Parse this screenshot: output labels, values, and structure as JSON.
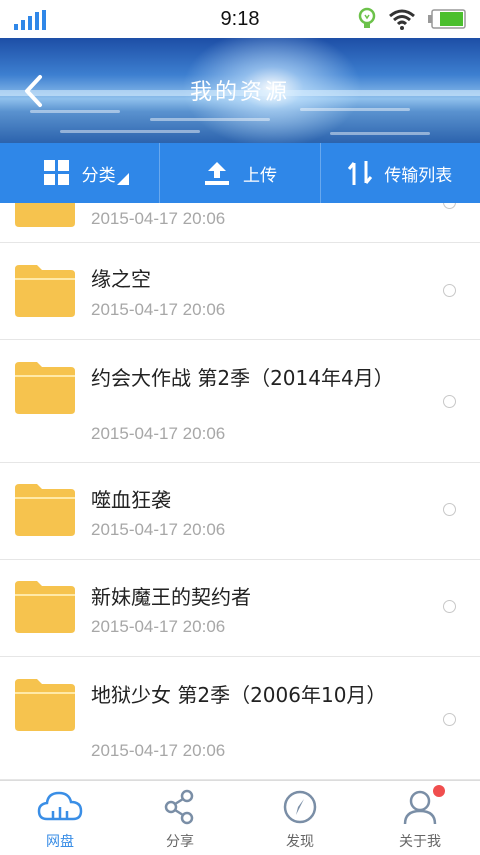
{
  "status_bar": {
    "time": "9:18"
  },
  "header": {
    "title": "我的资源"
  },
  "toolbar": {
    "category": "分类",
    "upload": "上传",
    "transfer_list": "传输列表"
  },
  "files": [
    {
      "name": "",
      "date": "2015-04-17  20:06"
    },
    {
      "name": "缘之空",
      "date": "2015-04-17  20:06"
    },
    {
      "name": "约会大作战 第2季（2014年4月）",
      "date": "2015-04-17  20:06"
    },
    {
      "name": "噬血狂袭",
      "date": "2015-04-17  20:06"
    },
    {
      "name": "新妹魔王的契约者",
      "date": "2015-04-17  20:06"
    },
    {
      "name": "地狱少女 第2季（2006年10月）",
      "date": "2015-04-17  20:06"
    }
  ],
  "tabs": [
    {
      "label": "网盘",
      "icon": "cloud-icon"
    },
    {
      "label": "分享",
      "icon": "share-icon"
    },
    {
      "label": "发现",
      "icon": "compass-icon"
    },
    {
      "label": "关于我",
      "icon": "person-icon"
    }
  ],
  "colors": {
    "accent": "#2f87e8",
    "folder": "#f6c34e",
    "active_tab": "#3a8ee6",
    "notification": "#f04e4e"
  }
}
